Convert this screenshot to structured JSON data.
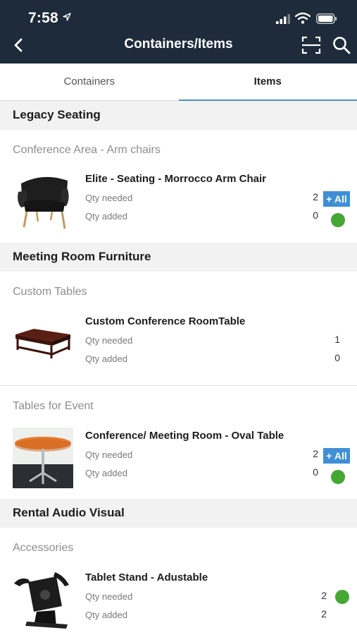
{
  "status_bar": {
    "time": "7:58"
  },
  "nav": {
    "title": "Containers/Items"
  },
  "tabs": [
    {
      "label": "Containers",
      "active": false
    },
    {
      "label": "Items",
      "active": true
    }
  ],
  "sections": [
    {
      "title": "Legacy Seating",
      "groups": [
        {
          "title": "Conference Area - Arm chairs",
          "items": [
            {
              "name": "Elite - Seating - Morrocco Arm Chair",
              "qty_needed_label": "Qty needed",
              "qty_added_label": "Qty added",
              "qty_needed": "2",
              "qty_added": "0",
              "all_button": "+ All"
            }
          ]
        }
      ]
    },
    {
      "title": "Meeting Room Furniture",
      "groups": [
        {
          "title": "Custom Tables",
          "items": [
            {
              "name": "Custom Conference RoomTable",
              "qty_needed_label": "Qty needed",
              "qty_added_label": "Qty added",
              "qty_needed": "1",
              "qty_added": "0"
            }
          ]
        },
        {
          "title": "Tables for Event",
          "items": [
            {
              "name": "Conference/ Meeting Room - Oval Table",
              "qty_needed_label": "Qty needed",
              "qty_added_label": "Qty added",
              "qty_needed": "2",
              "qty_added": "0",
              "all_button": "+ All"
            }
          ]
        }
      ]
    },
    {
      "title": "Rental Audio Visual",
      "groups": [
        {
          "title": "Accessories",
          "items": [
            {
              "name": "Tablet Stand - Adustable",
              "qty_needed_label": "Qty needed",
              "qty_added_label": "Qty added",
              "qty_needed": "2",
              "qty_added": "2"
            }
          ]
        }
      ]
    }
  ],
  "colors": {
    "header_bg": "#1d2b3a",
    "accent": "#4a90c8",
    "all_button": "#3f8fd6",
    "status_dot": "#44a832"
  }
}
